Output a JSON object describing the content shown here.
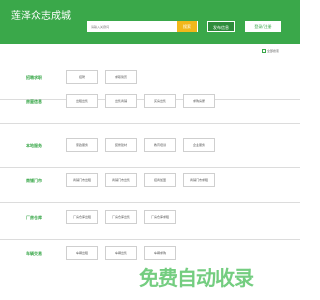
{
  "header": {
    "title": "莲泽众志成城",
    "search_placeholder": "请输入关键词",
    "search_button": "搜索",
    "post_button": "发布信息",
    "login_button": "登录/注册"
  },
  "breadcrumb": {
    "label": "全部搜索"
  },
  "sections": [
    {
      "title": "招聘求职",
      "tags": [
        "招聘",
        "求职简历"
      ]
    },
    {
      "title": "房屋信息",
      "tags": [
        "出租出售",
        "出售商铺",
        "买房出售",
        "求购房屋"
      ]
    },
    {
      "title": "本地服务",
      "tags": [
        "家政服务",
        "装修建材",
        "教育培训",
        "企业服务"
      ]
    },
    {
      "title": "商铺门市",
      "tags": [
        "商铺门市出租",
        "商铺门市出售",
        "招商加盟",
        "商铺门市求租"
      ]
    },
    {
      "title": "厂房仓库",
      "tags": [
        "厂房仓库出租",
        "厂房仓库出售",
        "厂房仓库求租"
      ]
    },
    {
      "title": "车辆交易",
      "tags": [
        "车辆出租",
        "车辆出售",
        "车辆求购"
      ]
    }
  ],
  "watermark": "免费自动收录",
  "colors": {
    "primary": "#3aa84a",
    "accent": "#f2b81a",
    "border": "#dcdcdc",
    "text": "#555555"
  }
}
